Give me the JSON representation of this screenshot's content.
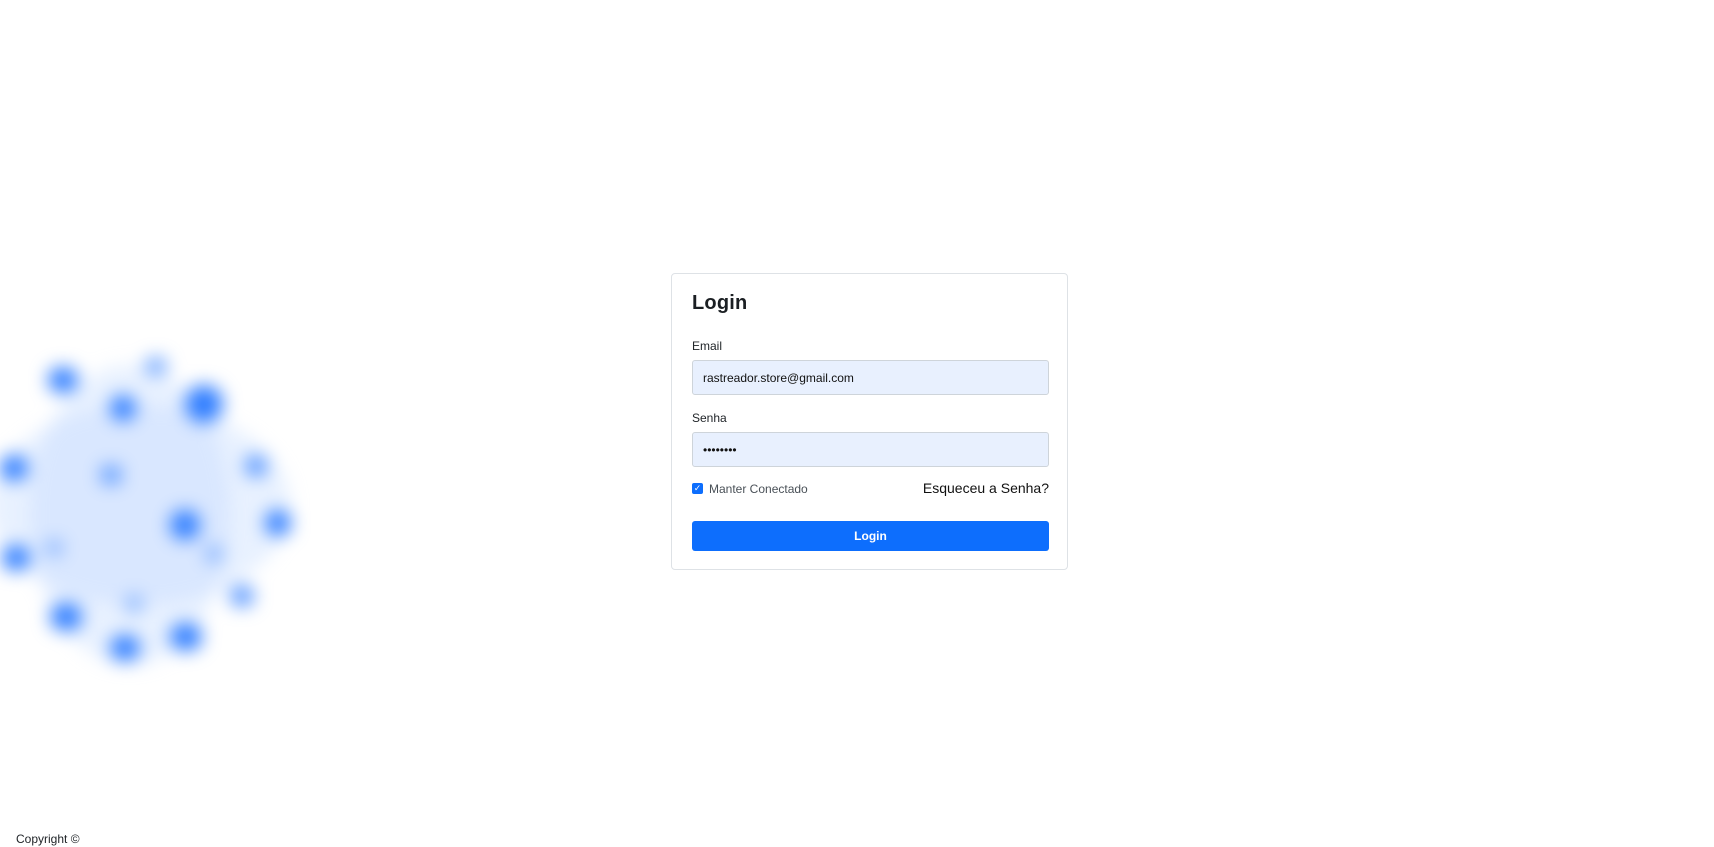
{
  "login": {
    "title": "Login",
    "email_label": "Email",
    "email_value": "rastreador.store@gmail.com",
    "password_label": "Senha",
    "password_value": "••••••••",
    "remember_label": "Manter Conectado",
    "remember_checked": true,
    "forgot_label": "Esqueceu a Senha?",
    "submit_label": "Login"
  },
  "footer": {
    "copyright": "Copyright ©"
  },
  "colors": {
    "primary": "#0d6efd",
    "input_autofill_bg": "#e8f0fe",
    "decor_blue": "#2f7dff"
  },
  "icons": {
    "checkbox": "check-icon"
  }
}
